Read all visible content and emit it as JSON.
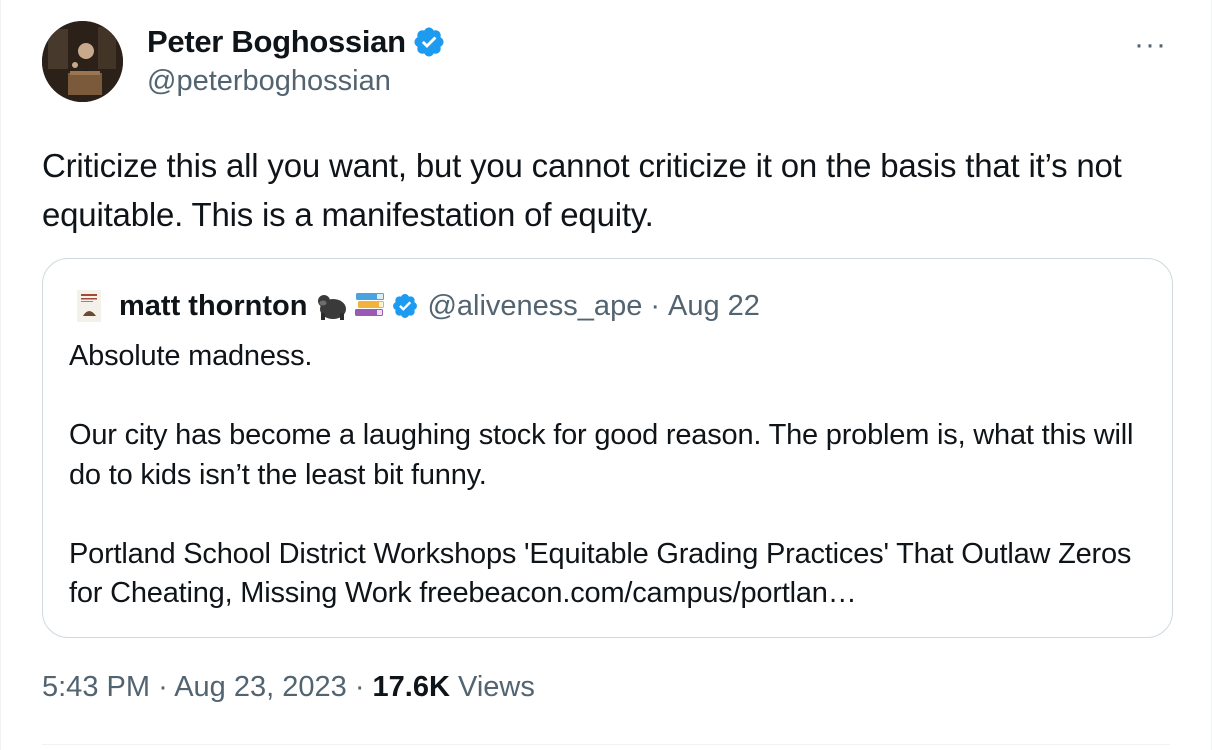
{
  "tweet": {
    "author": {
      "display_name": "Peter Boghossian",
      "handle": "@peterboghossian",
      "verified": true
    },
    "more_label": "···",
    "text": "Criticize this all you want, but you cannot criticize it on the basis that it’s not equitable. This is a manifestation of equity.",
    "quoted": {
      "display_name": "matt thornton",
      "emojis": [
        "gorilla",
        "books"
      ],
      "verified": true,
      "handle": "@aliveness_ape",
      "separator": "·",
      "date": "Aug 22",
      "paragraphs": [
        "Absolute madness.",
        "",
        "Our city has become a laughing stock for good reason. The problem is, what this will do to kids isn’t the least bit funny.",
        "",
        "Portland School District Workshops 'Equitable Grading Practices' That Outlaw Zeros for Cheating, Missing Work freebeacon.com/campus/portlan…"
      ]
    },
    "time": "5:43 PM",
    "sep": "·",
    "date": "Aug 23, 2023",
    "views_count": "17.6K",
    "views_label": "Views"
  },
  "colors": {
    "verified_blue": "#1d9bf0",
    "secondary_text": "#536471",
    "border": "#cfd9de"
  }
}
